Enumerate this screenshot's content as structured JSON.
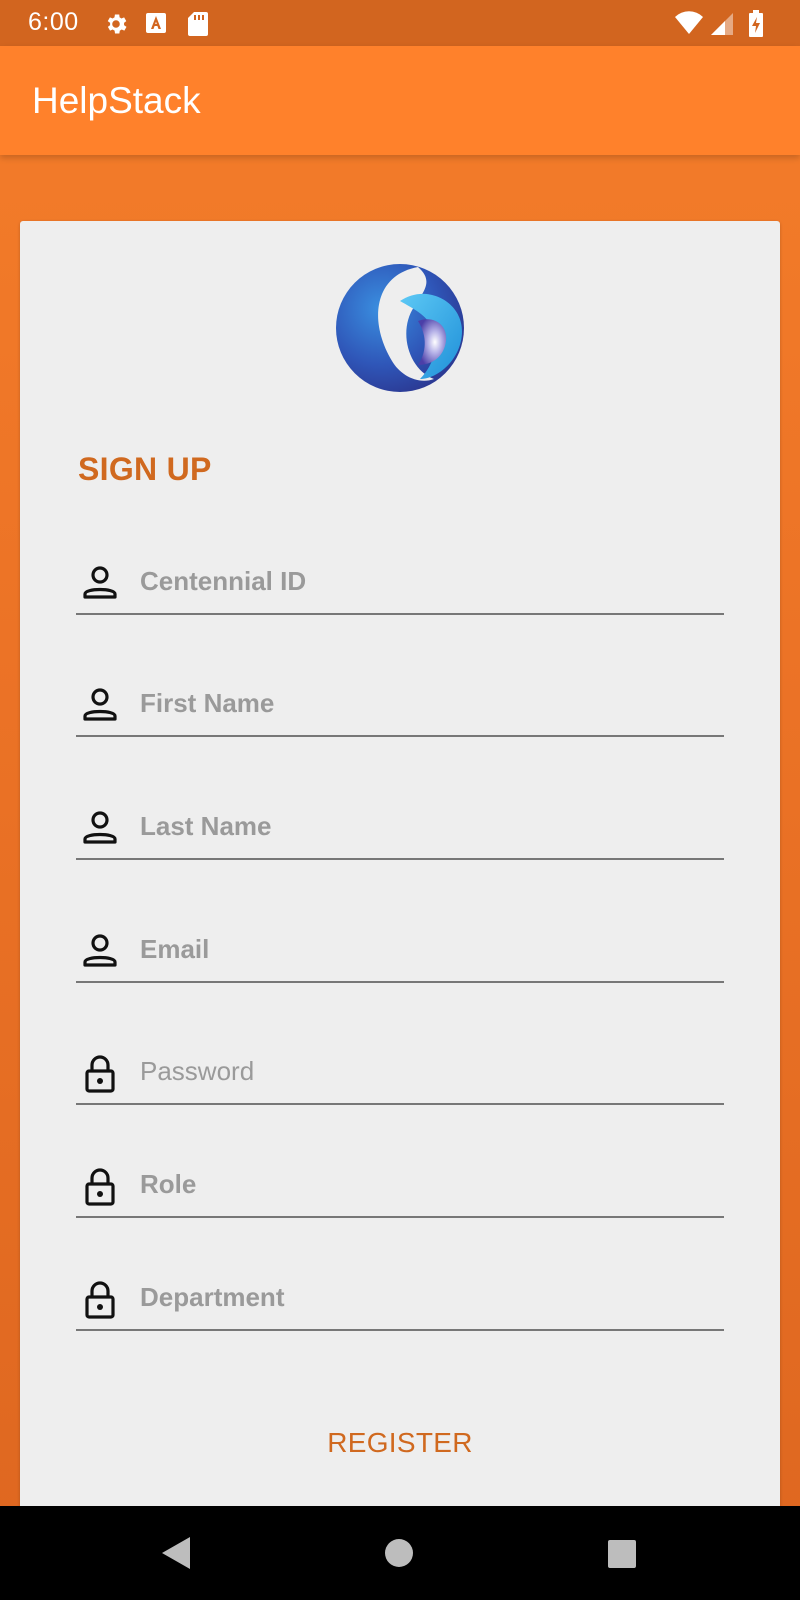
{
  "status_bar": {
    "time": "6:00",
    "left_icons": [
      "gear-icon",
      "font-a-icon",
      "sd-card-icon"
    ],
    "right_icons": [
      "wifi-icon",
      "cell-signal-icon",
      "battery-charging-icon"
    ]
  },
  "app_bar": {
    "title": "HelpStack"
  },
  "form": {
    "title": "SIGN UP",
    "fields": [
      {
        "icon": "person-icon",
        "placeholder": "Centennial ID",
        "value": ""
      },
      {
        "icon": "person-icon",
        "placeholder": "First Name",
        "value": ""
      },
      {
        "icon": "person-icon",
        "placeholder": "Last Name",
        "value": ""
      },
      {
        "icon": "person-icon",
        "placeholder": "Email",
        "value": ""
      },
      {
        "icon": "lock-icon",
        "placeholder": "Password",
        "value": ""
      },
      {
        "icon": "lock-icon",
        "placeholder": "Role",
        "value": ""
      },
      {
        "icon": "lock-icon",
        "placeholder": "Department",
        "value": ""
      }
    ],
    "register_label": "REGISTER"
  },
  "nav_bar": {
    "buttons": [
      "back-icon",
      "home-icon",
      "recents-icon"
    ]
  },
  "colors": {
    "status_bar": "#d2651f",
    "app_bar": "#ff812b",
    "accent_text": "#d0691f",
    "card": "#eeeeee"
  }
}
